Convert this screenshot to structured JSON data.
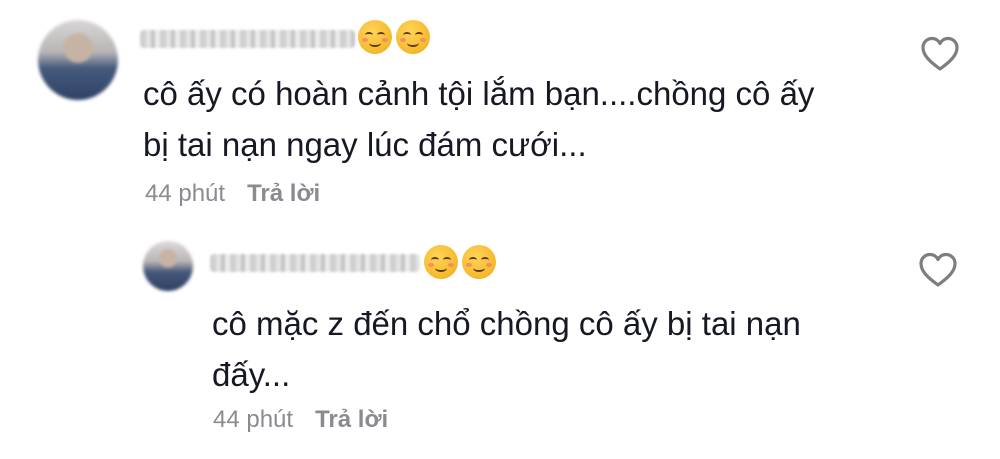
{
  "comments": [
    {
      "emojis": [
        "☺️",
        "☺️"
      ],
      "text_line1": "cô ấy có hoàn cảnh tội lắm bạn....chồng cô ấy",
      "text_line2": "bị tai nạn ngay lúc đám cưới...",
      "time": "44 phút",
      "reply_label": "Trả lời",
      "like_icon": "heart-outline-icon"
    },
    {
      "emojis": [
        "☺️",
        "☺️"
      ],
      "text_line1": "cô mặc z đến chổ chồng cô ấy bị tai nạn",
      "text_line2": "đấy...",
      "time": "44 phút",
      "reply_label": "Trả lời",
      "like_icon": "heart-outline-icon"
    }
  ],
  "colors": {
    "text": "#161823",
    "meta": "#8a8b91",
    "icon_stroke": "#7d7e82"
  }
}
